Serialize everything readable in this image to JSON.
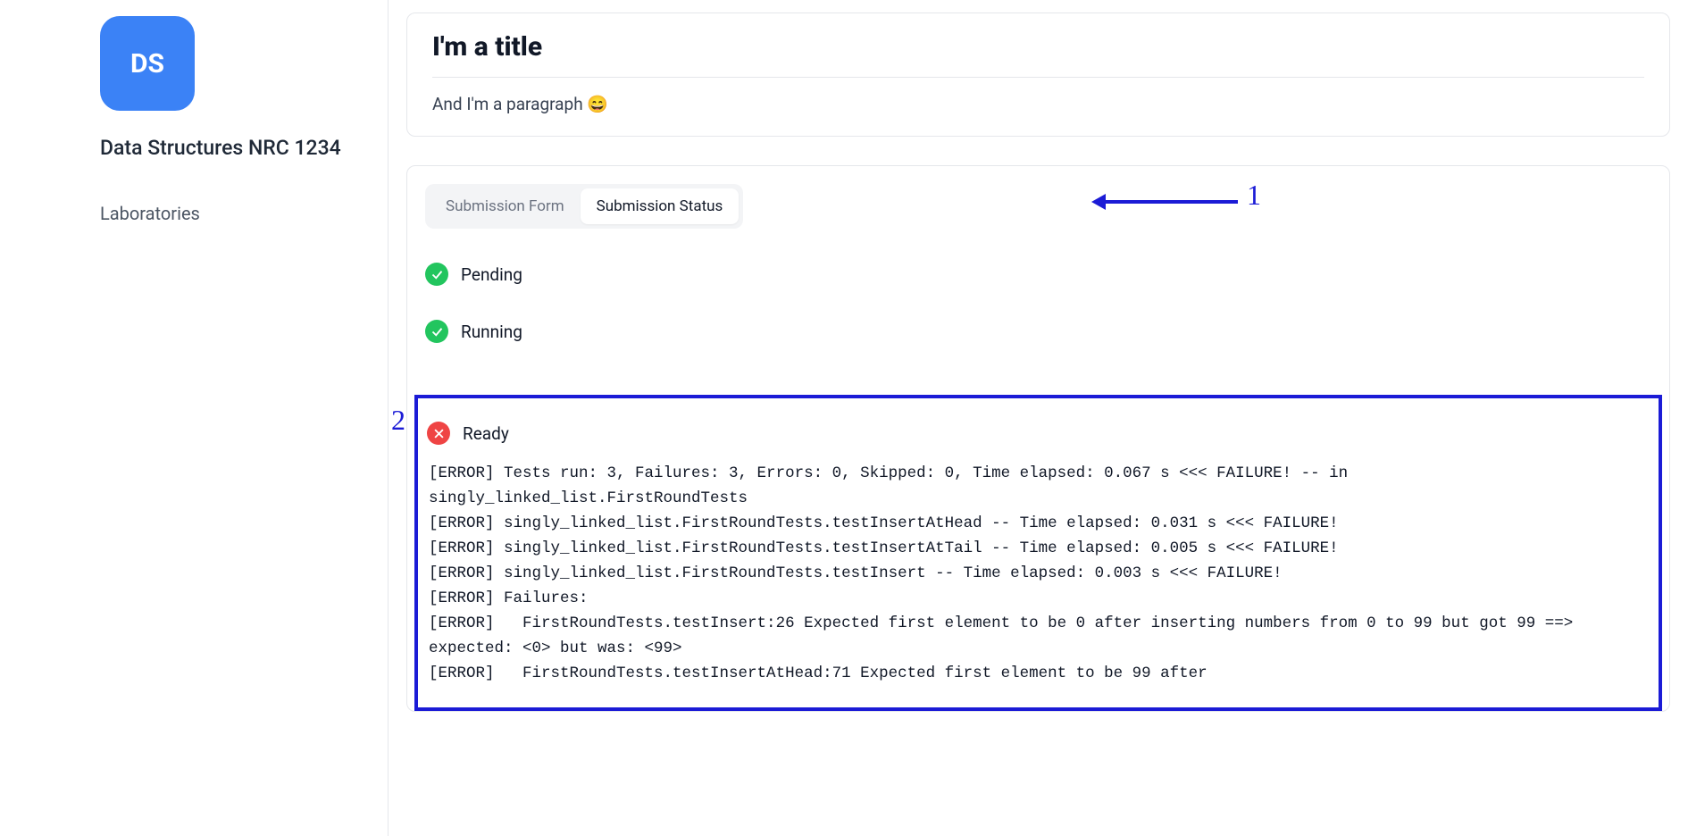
{
  "sidebar": {
    "badge": "DS",
    "course_title": "Data Structures NRC 1234",
    "nav_item": "Laboratories"
  },
  "header_card": {
    "title": "I'm a title",
    "paragraph": "And I'm a paragraph 😄"
  },
  "tabs": {
    "form": "Submission Form",
    "status": "Submission Status"
  },
  "statuses": {
    "pending": "Pending",
    "running": "Running",
    "ready": "Ready"
  },
  "log_text": "[ERROR] Tests run: 3, Failures: 3, Errors: 0, Skipped: 0, Time elapsed: 0.067 s <<< FAILURE! -- in singly_linked_list.FirstRoundTests\n[ERROR] singly_linked_list.FirstRoundTests.testInsertAtHead -- Time elapsed: 0.031 s <<< FAILURE!\n[ERROR] singly_linked_list.FirstRoundTests.testInsertAtTail -- Time elapsed: 0.005 s <<< FAILURE!\n[ERROR] singly_linked_list.FirstRoundTests.testInsert -- Time elapsed: 0.003 s <<< FAILURE!\n[ERROR] Failures:\n[ERROR]   FirstRoundTests.testInsert:26 Expected first element to be 0 after inserting numbers from 0 to 99 but got 99 ==> expected: <0> but was: <99>\n[ERROR]   FirstRoundTests.testInsertAtHead:71 Expected first element to be 99 after",
  "annotations": {
    "one": "1",
    "two": "2"
  }
}
